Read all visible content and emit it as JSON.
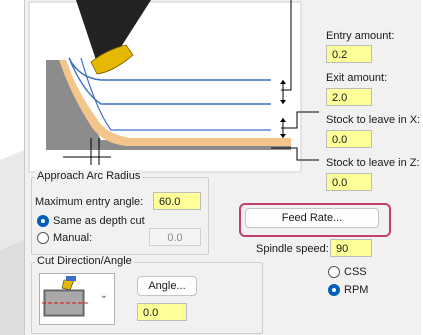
{
  "stock": {
    "entry_label": "Entry amount:",
    "entry_value": "0.2",
    "exit_label": "Exit amount:",
    "exit_value": "2.0",
    "leave_x_label": "Stock to leave in X:",
    "leave_x_value": "0.0",
    "leave_z_label": "Stock to leave in Z:",
    "leave_z_value": "0.0"
  },
  "approach": {
    "title": "Approach Arc Radius",
    "max_angle_label": "Maximum entry angle:",
    "max_angle_value": "60.0",
    "same_depth_label": "Same as depth cut",
    "manual_label": "Manual:",
    "manual_value": "0.0"
  },
  "cut": {
    "title": "Cut Direction/Angle",
    "angle_button": "Angle...",
    "angle_value": "0.0"
  },
  "feed": {
    "button": "Feed Rate...",
    "spindle_label": "Spindle speed:",
    "spindle_value": "90",
    "css_label": "CSS",
    "rpm_label": "RPM"
  },
  "colors": {
    "field_yellow": "#ffff99",
    "radio_selected": "#005fb8",
    "highlight": "#c0426a"
  }
}
